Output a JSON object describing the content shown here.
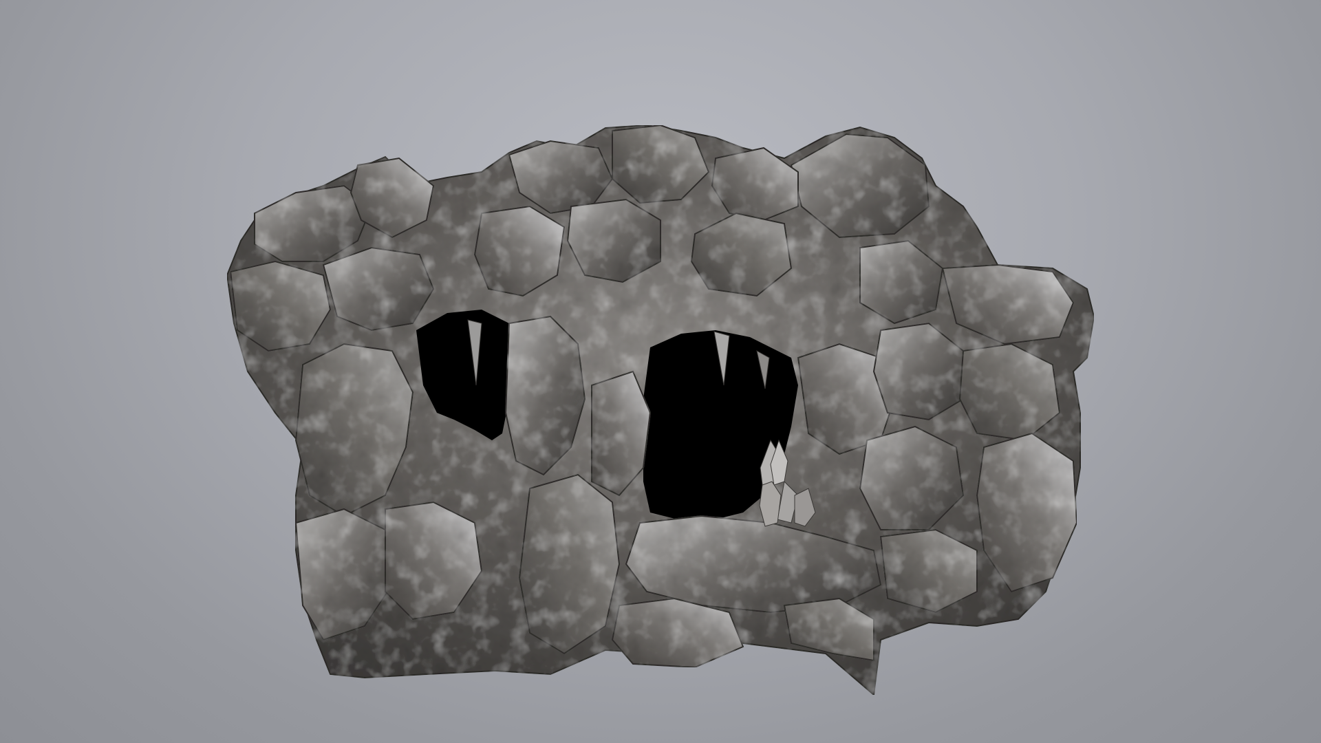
{
  "viewer": {
    "background_top": "#b9bbc2",
    "background_bottom": "#8d8f95"
  },
  "model": {
    "subject": "rock-cave",
    "rock_base_color": "#5d5a57",
    "rock_dark_color": "#2f2d2c",
    "rock_light_color": "#c9c9cb",
    "cave_interior_color": "#000000"
  }
}
